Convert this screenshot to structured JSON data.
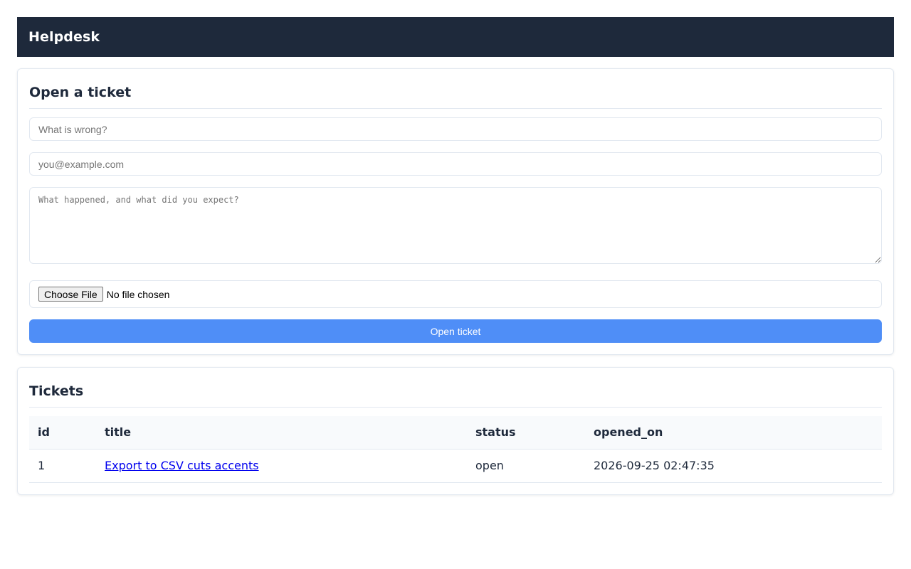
{
  "header": {
    "brand": "Helpdesk"
  },
  "form": {
    "heading": "Open a ticket",
    "title_placeholder": "What is wrong?",
    "email_placeholder": "you@example.com",
    "body_placeholder": "What happened, and what did you expect?",
    "file_button": "Choose File",
    "file_status": "No file chosen",
    "submit_label": "Open ticket",
    "accent_color": "#4f8ef7"
  },
  "tickets": {
    "heading": "Tickets",
    "columns": [
      "id",
      "title",
      "status",
      "opened_on"
    ],
    "rows": [
      {
        "id": "1",
        "title": "Export to CSV cuts accents",
        "status": "open",
        "opened_on": "2026-09-25 02:47:35"
      }
    ]
  }
}
